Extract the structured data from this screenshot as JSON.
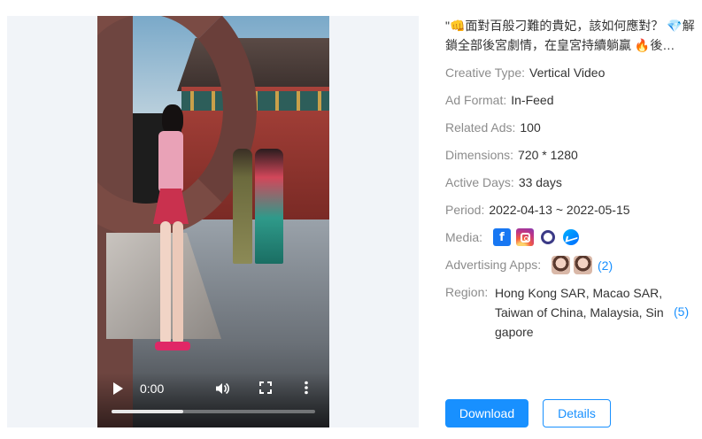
{
  "video": {
    "time": "0:00",
    "progress_fraction": 0.35
  },
  "ad": {
    "title": "\"👊面對百般刁難的貴妃，該如何應對？ 💎解鎖全部後宮劇情，在皇宮持續躺贏 🔥後…",
    "fields": {
      "creative_type": {
        "label": "Creative Type:",
        "value": "Vertical Video"
      },
      "ad_format": {
        "label": "Ad Format:",
        "value": "In-Feed"
      },
      "related_ads": {
        "label": "Related Ads:",
        "value": "100"
      },
      "dimensions": {
        "label": "Dimensions:",
        "value": "720 * 1280"
      },
      "active_days": {
        "label": "Active Days:",
        "value": "33 days"
      },
      "period": {
        "label": "Period:",
        "value": "2022-04-13 ~ 2022-05-15"
      },
      "media": {
        "label": "Media:",
        "icons": [
          "facebook-icon",
          "instagram-icon",
          "audience-network-icon",
          "messenger-icon"
        ]
      },
      "advertising_apps": {
        "label": "Advertising Apps:",
        "count": "(2)"
      },
      "region": {
        "label": "Region:",
        "value": "Hong Kong SAR, Macao SAR, Taiwan of China, Malaysia, Sin gapore",
        "count": "(5)"
      }
    }
  },
  "actions": {
    "download_label": "Download",
    "details_label": "Details"
  },
  "colors": {
    "primary": "#1890ff",
    "panel_bg": "#f1f4f8",
    "label_gray": "#8c8c8c"
  }
}
